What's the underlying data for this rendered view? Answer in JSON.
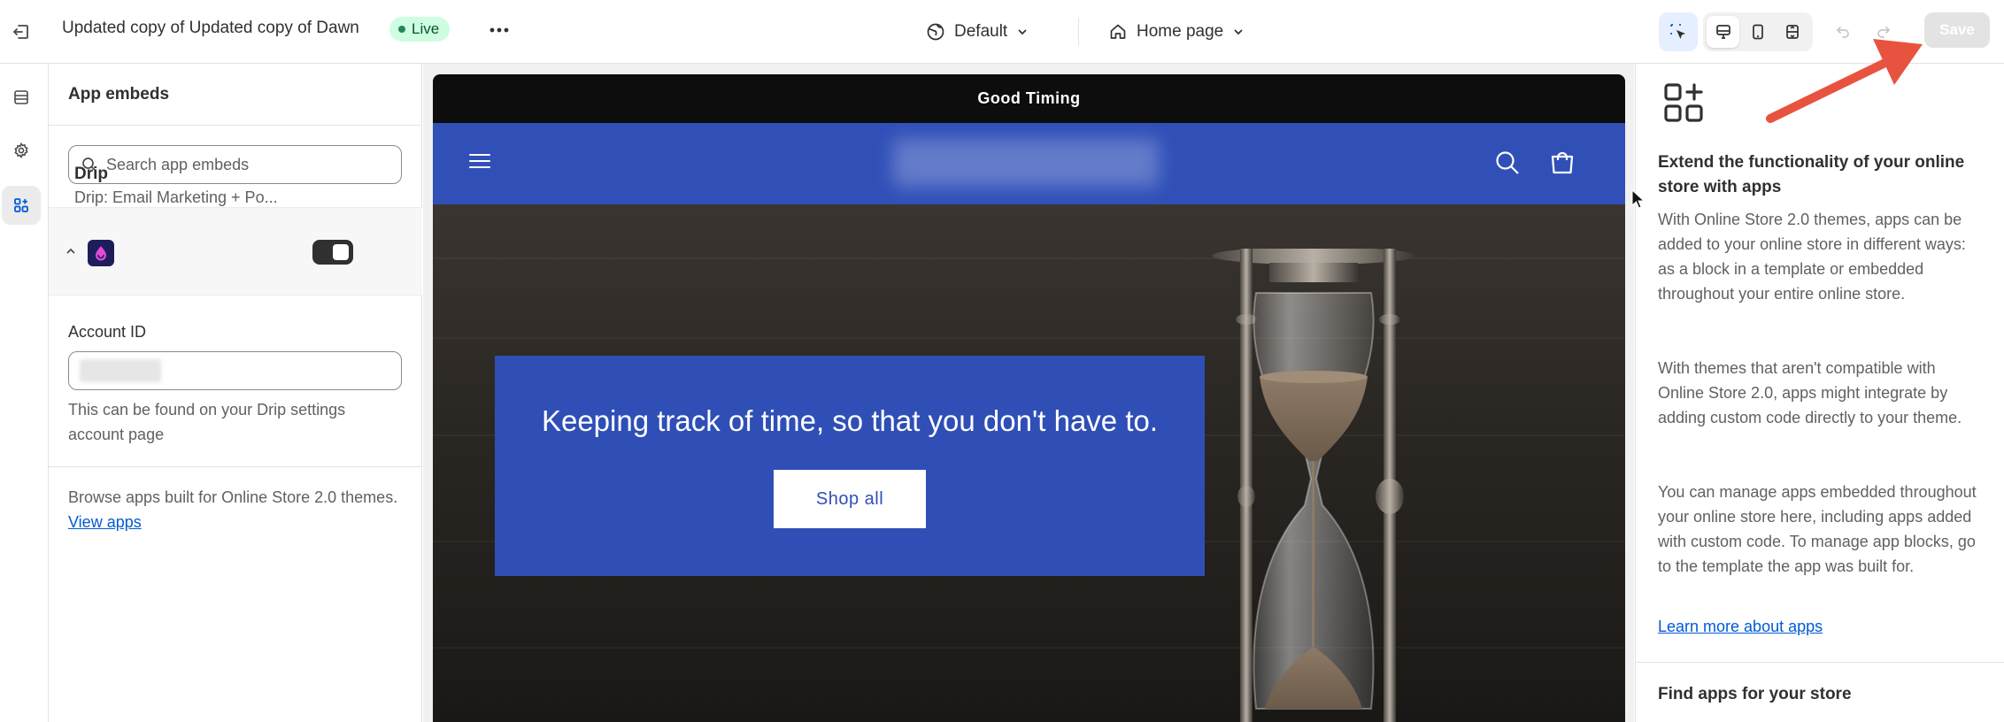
{
  "topbar": {
    "store_title": "Updated copy of Updated copy of Dawn",
    "live_badge": "Live",
    "theme_select": "Default",
    "page_select": "Home page",
    "save_label": "Save"
  },
  "left_panel": {
    "title": "App embeds",
    "search_placeholder": "Search app embeds",
    "app": {
      "name": "Drip",
      "subtitle": "Drip: Email Marketing + Po...",
      "enabled": true
    },
    "account_label": "Account ID",
    "account_help": "This can be found on your Drip settings account page",
    "browse_text": "Browse apps built for Online Store 2.0 themes.",
    "view_apps_link": "View apps"
  },
  "preview": {
    "announcement": "Good Timing",
    "hero_heading": "Keeping track of time, so that you don't have to.",
    "hero_button": "Shop all",
    "header_color": "#3050b8"
  },
  "right_panel": {
    "title": "Extend the functionality of your online store with apps",
    "p1": "With Online Store 2.0 themes, apps can be added to your online store in different ways: as a block in a template or embedded throughout your entire online store.",
    "p2": "With themes that aren't compatible with Online Store 2.0, apps might integrate by adding custom code directly to your theme.",
    "p3": "You can manage apps embedded throughout your online store here, including apps added with custom code. To manage app blocks, go to the template the app was built for.",
    "learn_more": "Learn more about apps",
    "find_apps": "Find apps for your store"
  },
  "colors": {
    "accent_blue": "#005bd3",
    "live_green": "#cdfee1",
    "annotation_arrow": "#e8533f"
  }
}
